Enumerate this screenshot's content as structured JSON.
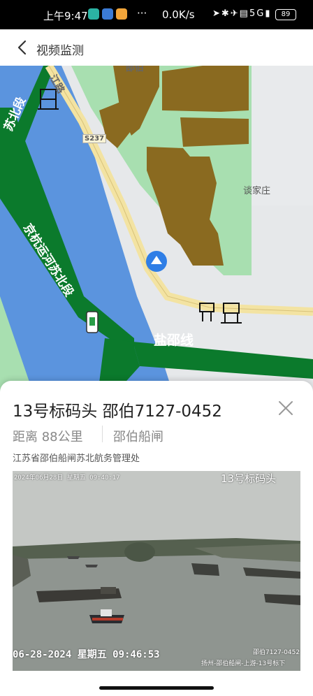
{
  "status_bar": {
    "time": "上午9:47",
    "more": "···",
    "net_speed": "0.0K/s",
    "network": "5G",
    "battery": "89"
  },
  "header": {
    "title": "视频监测"
  },
  "map": {
    "road_top": "江路",
    "road_code": "S237",
    "village": "谈家庄",
    "canal_name": "京杭运河苏北段",
    "canal_left": "苏北段",
    "line_name": "盐邵线",
    "top_label": "邵伯"
  },
  "panel": {
    "name": "13号标码头 邵伯7127-0452",
    "distance": "距离 88公里",
    "lock": "邵伯船闸",
    "org": "江苏省邵伯船闸苏北航务管理处"
  },
  "video": {
    "osd_top_date": "2024年06月28日 星期五 09:40:17",
    "osd_top_name": "13号标码头",
    "osd_bottom_date": "06-28-2024 星期五 09:46:53",
    "osd_bottom_right1": "邵伯7127-0452",
    "osd_bottom_right2": "扬州-邵伯船闸-上游-13号标下"
  },
  "colors": {
    "water": "#5b94de",
    "canal_green": "#0b7a2c",
    "land_green": "#a8dfb0",
    "building": "#8a6a20",
    "road": "#f3e3a2",
    "poi_blue": "#2f7ee6"
  }
}
